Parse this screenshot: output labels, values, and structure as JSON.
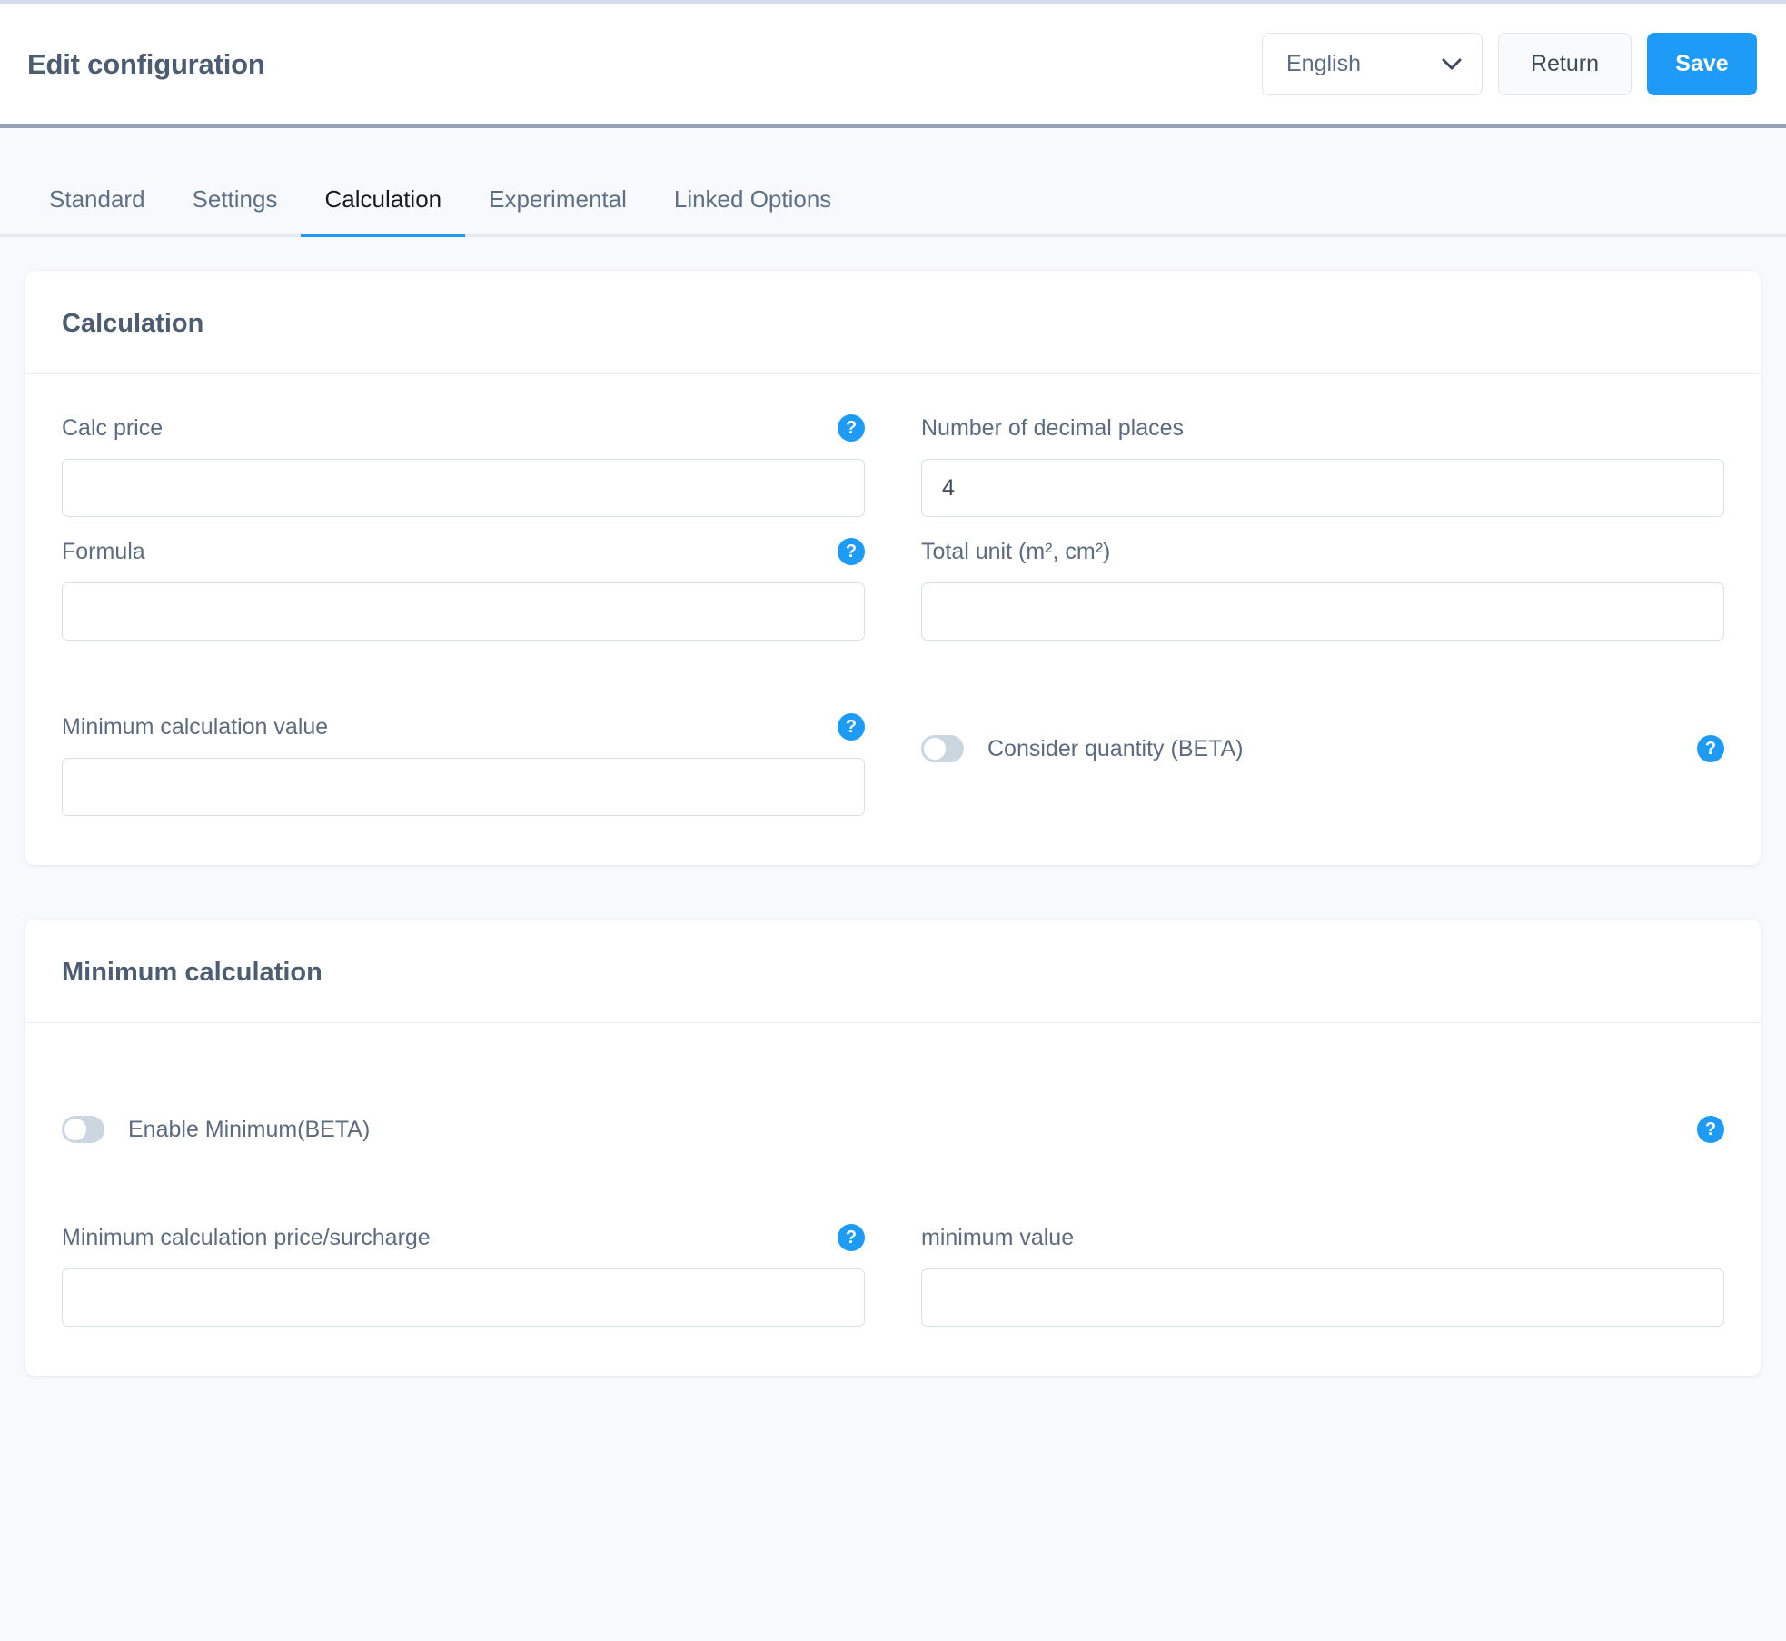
{
  "header": {
    "title": "Edit configuration",
    "language": {
      "value": "English",
      "icon": "chevron-down-icon"
    },
    "return_label": "Return",
    "save_label": "Save"
  },
  "tabs": [
    {
      "label": "Standard",
      "active": false
    },
    {
      "label": "Settings",
      "active": false
    },
    {
      "label": "Calculation",
      "active": true
    },
    {
      "label": "Experimental",
      "active": false
    },
    {
      "label": "Linked Options",
      "active": false
    }
  ],
  "cards": [
    {
      "title": "Calculation",
      "fields": {
        "calc_price": {
          "label": "Calc price",
          "value": "",
          "placeholder": "",
          "help": "?"
        },
        "formula": {
          "label": "Formula",
          "value": "",
          "placeholder": "",
          "help": "?"
        },
        "minimum_calculation_value": {
          "label": "Minimum calculation value",
          "value": "",
          "placeholder": "",
          "help": "?"
        },
        "decimal_places": {
          "label": "Number of decimal places",
          "value": "4",
          "placeholder": ""
        },
        "total_unit": {
          "label": "Total unit (m², cm²)",
          "value": "",
          "placeholder": ""
        },
        "consider_quantity": {
          "label": "Consider quantity (BETA)",
          "state": "off",
          "help": "?"
        }
      }
    },
    {
      "title": "Minimum calculation",
      "fields": {
        "enable_minimum": {
          "label": "Enable Minimum(BETA)",
          "state": "off",
          "help": "?"
        },
        "minimum_price_surcharge": {
          "label": "Minimum calculation price/surcharge",
          "value": "",
          "placeholder": "",
          "help": "?"
        },
        "minimum_value": {
          "label": "minimum value",
          "value": "",
          "placeholder": ""
        }
      }
    }
  ],
  "colors": {
    "accent": "#1d9bf6",
    "page_background": "#f7f9fc",
    "label_text": "#5c6b80",
    "title_text": "#4c5d72",
    "header_border": "#93a3b8",
    "toggle_off": "#ccd6e0"
  }
}
